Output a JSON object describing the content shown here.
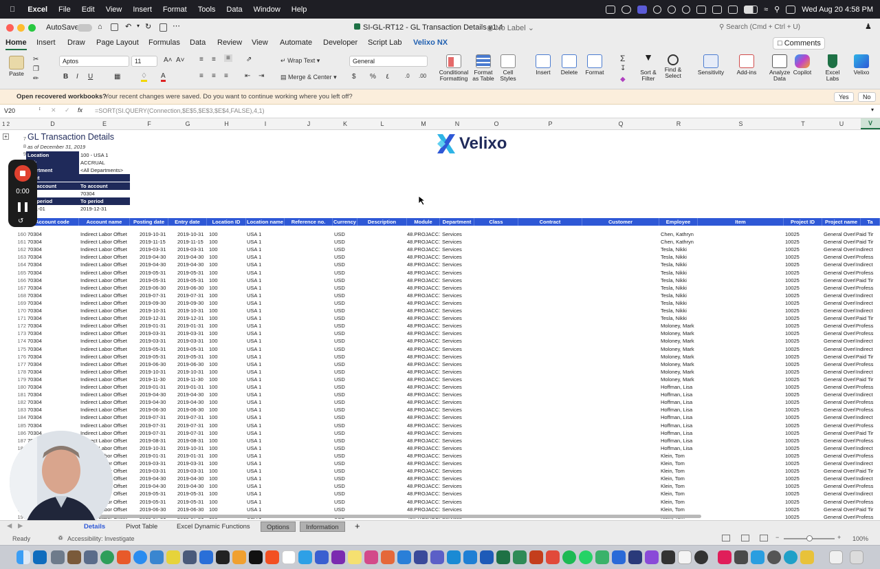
{
  "menubar": {
    "app": "Excel",
    "items": [
      "File",
      "Edit",
      "View",
      "Insert",
      "Format",
      "Tools",
      "Data",
      "Window",
      "Help"
    ],
    "datetime": "Wed Aug 20  4:58 PM"
  },
  "titlebar": {
    "autosave": "AutoSave",
    "title": "SI-GL-RT12 - GL Transaction Details v1.4",
    "label": "No Label",
    "search_placeholder": "Search (Cmd + Ctrl + U)"
  },
  "ribbon_tabs": [
    "Home",
    "Insert",
    "Draw",
    "Page Layout",
    "Formulas",
    "Data",
    "Review",
    "View",
    "Automate",
    "Developer",
    "Script Lab",
    "Velixo NX"
  ],
  "comments": "Comments",
  "ribbon": {
    "paste": "Paste",
    "font": "Aptos",
    "size": "11",
    "wrap": "Wrap Text",
    "merge": "Merge & Center",
    "numfmt": "General",
    "cond": [
      "Conditional",
      "Formatting"
    ],
    "fat": [
      "Format",
      "as Table"
    ],
    "cellstyles": [
      "Cell",
      "Styles"
    ],
    "insert": "Insert",
    "delete": "Delete",
    "format": "Format",
    "sortfilter": [
      "Sort &",
      "Filter"
    ],
    "findselect": [
      "Find &",
      "Select"
    ],
    "sensitivity": "Sensitivity",
    "addins": "Add-ins",
    "analyze": [
      "Analyze",
      "Data"
    ],
    "copilot": "Copilot",
    "excellabs": [
      "Excel",
      "Labs"
    ],
    "velixo": "Velixo"
  },
  "infobar": {
    "title": "Open recovered workbooks?",
    "message": "Your recent changes were saved. Do you want to continue working where you left off?",
    "yes": "Yes",
    "no": "No"
  },
  "formula": {
    "cell": "V20",
    "text": "=SORT(SI.QUERY(Connection,$E$5,$E$3,$E$4,FALSE),4,1)",
    "fx": "fx"
  },
  "columns": [
    "D",
    "E",
    "F",
    "G",
    "H",
    "I",
    "J",
    "K",
    "L",
    "M",
    "N",
    "O",
    "P",
    "Q",
    "R",
    "S",
    "T",
    "U",
    "V"
  ],
  "report": {
    "title": "GL Transaction Details",
    "asof": "as of December 31, 2019",
    "brand": "Velixo",
    "params": [
      {
        "label": "Location",
        "value": "100 - USA 1"
      },
      {
        "label": "ook",
        "value": "ACCRUAL"
      },
      {
        "label": "epartment",
        "value": "<All Departments>"
      },
      {
        "label": "oject",
        "value": ""
      },
      {
        "label": "om account",
        "value": "To account"
      },
      {
        "label": "04",
        "value": "70304"
      },
      {
        "label": "om period",
        "value": "To period"
      },
      {
        "label": "9-01-01",
        "value": "2019-12-31"
      }
    ],
    "rownums_top": [
      "7",
      "8",
      "9"
    ]
  },
  "table": {
    "headers": [
      "Account code",
      "Account name",
      "Posting date",
      "Entry date",
      "Location ID",
      "Location name",
      "Reference no.",
      "Currency",
      "Description",
      "Module",
      "Department",
      "Class",
      "Contract",
      "Customer",
      "Employee",
      "Item",
      "Project ID",
      "Project name",
      "Ta"
    ],
    "rows": [
      [
        "160",
        "70304",
        "Indirect Labor Offset",
        "2019-10-31",
        "2019-10-31",
        "100",
        "USA 1",
        "USD",
        "48.PROJACC1",
        "Services",
        "Chen, Kathryn",
        "10025",
        "General Overhe",
        "Paid Tir"
      ],
      [
        "161",
        "70304",
        "Indirect Labor Offset",
        "2019-11-15",
        "2019-11-15",
        "100",
        "USA 1",
        "USD",
        "48.PROJACC1",
        "Services",
        "Chen, Kathryn",
        "10025",
        "General Overhe",
        "Paid Tir"
      ],
      [
        "162",
        "70304",
        "Indirect Labor Offset",
        "2019-03-31",
        "2019-03-31",
        "100",
        "USA 1",
        "USD",
        "48.PROJACC1",
        "Services",
        "Tesla, Nikki",
        "10025",
        "General Overhe",
        "Indirect"
      ],
      [
        "163",
        "70304",
        "Indirect Labor Offset",
        "2019-04-30",
        "2019-04-30",
        "100",
        "USA 1",
        "USD",
        "48.PROJACC1",
        "Services",
        "Tesla, Nikki",
        "10025",
        "General Overhe",
        "Profess"
      ],
      [
        "164",
        "70304",
        "Indirect Labor Offset",
        "2019-04-30",
        "2019-04-30",
        "100",
        "USA 1",
        "USD",
        "48.PROJACC1",
        "Services",
        "Tesla, Nikki",
        "10025",
        "General Overhe",
        "Indirect"
      ],
      [
        "165",
        "70304",
        "Indirect Labor Offset",
        "2019-05-31",
        "2019-05-31",
        "100",
        "USA 1",
        "USD",
        "48.PROJACC1",
        "Services",
        "Tesla, Nikki",
        "10025",
        "General Overhe",
        "Profess"
      ],
      [
        "166",
        "70304",
        "Indirect Labor Offset",
        "2019-05-31",
        "2019-05-31",
        "100",
        "USA 1",
        "USD",
        "48.PROJACC1",
        "Services",
        "Tesla, Nikki",
        "10025",
        "General Overhe",
        "Paid Tir"
      ],
      [
        "167",
        "70304",
        "Indirect Labor Offset",
        "2019-06-30",
        "2019-06-30",
        "100",
        "USA 1",
        "USD",
        "48.PROJACC1",
        "Services",
        "Tesla, Nikki",
        "10025",
        "General Overhe",
        "Profess"
      ],
      [
        "168",
        "70304",
        "Indirect Labor Offset",
        "2019-07-31",
        "2019-07-31",
        "100",
        "USA 1",
        "USD",
        "48.PROJACC1",
        "Services",
        "Tesla, Nikki",
        "10025",
        "General Overhe",
        "Indirect"
      ],
      [
        "169",
        "70304",
        "Indirect Labor Offset",
        "2019-09-30",
        "2019-09-30",
        "100",
        "USA 1",
        "USD",
        "48.PROJACC1",
        "Services",
        "Tesla, Nikki",
        "10025",
        "General Overhe",
        "Indirect"
      ],
      [
        "170",
        "70304",
        "Indirect Labor Offset",
        "2019-10-31",
        "2019-10-31",
        "100",
        "USA 1",
        "USD",
        "48.PROJACC1",
        "Services",
        "Tesla, Nikki",
        "10025",
        "General Overhe",
        "Indirect"
      ],
      [
        "171",
        "70304",
        "Indirect Labor Offset",
        "2019-12-31",
        "2019-12-31",
        "100",
        "USA 1",
        "USD",
        "48.PROJACC1",
        "Services",
        "Tesla, Nikki",
        "10025",
        "General Overhe",
        "Paid Tir"
      ],
      [
        "172",
        "70304",
        "Indirect Labor Offset",
        "2019-01-31",
        "2019-01-31",
        "100",
        "USA 1",
        "USD",
        "48.PROJACC1",
        "Services",
        "Moloney, Mark",
        "10025",
        "General Overhe",
        "Profess"
      ],
      [
        "173",
        "70304",
        "Indirect Labor Offset",
        "2019-03-31",
        "2019-03-31",
        "100",
        "USA 1",
        "USD",
        "48.PROJACC1",
        "Services",
        "Moloney, Mark",
        "10025",
        "General Overhe",
        "Profess"
      ],
      [
        "174",
        "70304",
        "Indirect Labor Offset",
        "2019-03-31",
        "2019-03-31",
        "100",
        "USA 1",
        "USD",
        "48.PROJACC1",
        "Services",
        "Moloney, Mark",
        "10025",
        "General Overhe",
        "Indirect"
      ],
      [
        "175",
        "70304",
        "Indirect Labor Offset",
        "2019-05-31",
        "2019-05-31",
        "100",
        "USA 1",
        "USD",
        "48.PROJACC1",
        "Services",
        "Moloney, Mark",
        "10025",
        "General Overhe",
        "Indirect"
      ],
      [
        "176",
        "70304",
        "Indirect Labor Offset",
        "2019-05-31",
        "2019-05-31",
        "100",
        "USA 1",
        "USD",
        "48.PROJACC1",
        "Services",
        "Moloney, Mark",
        "10025",
        "General Overhe",
        "Paid Tir"
      ],
      [
        "177",
        "70304",
        "Indirect Labor Offset",
        "2019-06-30",
        "2019-06-30",
        "100",
        "USA 1",
        "USD",
        "48.PROJACC1",
        "Services",
        "Moloney, Mark",
        "10025",
        "General Overhe",
        "Profess"
      ],
      [
        "178",
        "70304",
        "Indirect Labor Offset",
        "2019-10-31",
        "2019-10-31",
        "100",
        "USA 1",
        "USD",
        "48.PROJACC1",
        "Services",
        "Moloney, Mark",
        "10025",
        "General Overhe",
        "Indirect"
      ],
      [
        "179",
        "70304",
        "Indirect Labor Offset",
        "2019-11-30",
        "2019-11-30",
        "100",
        "USA 1",
        "USD",
        "48.PROJACC1",
        "Services",
        "Moloney, Mark",
        "10025",
        "General Overhe",
        "Paid Tir"
      ],
      [
        "180",
        "70304",
        "Indirect Labor Offset",
        "2019-01-31",
        "2019-01-31",
        "100",
        "USA 1",
        "USD",
        "48.PROJACC1",
        "Services",
        "Hoffman, Lisa",
        "10025",
        "General Overhe",
        "Profess"
      ],
      [
        "181",
        "70304",
        "Indirect Labor Offset",
        "2019-04-30",
        "2019-04-30",
        "100",
        "USA 1",
        "USD",
        "48.PROJACC1",
        "Services",
        "Hoffman, Lisa",
        "10025",
        "General Overhe",
        "Indirect"
      ],
      [
        "182",
        "70304",
        "Indirect Labor Offset",
        "2019-04-30",
        "2019-04-30",
        "100",
        "USA 1",
        "USD",
        "48.PROJACC1",
        "Services",
        "Hoffman, Lisa",
        "10025",
        "General Overhe",
        "Profess"
      ],
      [
        "183",
        "70304",
        "Indirect Labor Offset",
        "2019-06-30",
        "2019-06-30",
        "100",
        "USA 1",
        "USD",
        "48.PROJACC1",
        "Services",
        "Hoffman, Lisa",
        "10025",
        "General Overhe",
        "Profess"
      ],
      [
        "184",
        "70304",
        "Indirect Labor Offset",
        "2019-07-31",
        "2019-07-31",
        "100",
        "USA 1",
        "USD",
        "48.PROJACC1",
        "Services",
        "Hoffman, Lisa",
        "10025",
        "General Overhe",
        "Indirect"
      ],
      [
        "185",
        "70304",
        "Indirect Labor Offset",
        "2019-07-31",
        "2019-07-31",
        "100",
        "USA 1",
        "USD",
        "48.PROJACC1",
        "Services",
        "Hoffman, Lisa",
        "10025",
        "General Overhe",
        "Profess"
      ],
      [
        "186",
        "70304",
        "Indirect Labor Offset",
        "2019-07-31",
        "2019-07-31",
        "100",
        "USA 1",
        "USD",
        "48.PROJACC1",
        "Services",
        "Hoffman, Lisa",
        "10025",
        "General Overhe",
        "Paid Tir"
      ],
      [
        "187",
        "70304",
        "Indirect Labor Offset",
        "2019-08-31",
        "2019-08-31",
        "100",
        "USA 1",
        "USD",
        "48.PROJACC1",
        "Services",
        "Hoffman, Lisa",
        "10025",
        "General Overhe",
        "Profess"
      ],
      [
        "188",
        "70304",
        "Indirect Labor Offset",
        "2019-10-31",
        "2019-10-31",
        "100",
        "USA 1",
        "USD",
        "48.PROJACC1",
        "Services",
        "Hoffman, Lisa",
        "10025",
        "General Overhe",
        "Indirect"
      ],
      [
        "189",
        "70304",
        "Indirect Labor Offset",
        "2019-01-31",
        "2019-01-31",
        "100",
        "USA 1",
        "USD",
        "48.PROJACC1",
        "Services",
        "Klein, Tom",
        "10025",
        "General Overhe",
        "Profess"
      ],
      [
        "190",
        "70304",
        "Indirect Labor Offset",
        "2019-03-31",
        "2019-03-31",
        "100",
        "USA 1",
        "USD",
        "48.PROJACC1",
        "Services",
        "Klein, Tom",
        "10025",
        "General Overhe",
        "Indirect"
      ],
      [
        "191",
        "70304",
        "Indirect Labor Offset",
        "2019-03-31",
        "2019-03-31",
        "100",
        "USA 1",
        "USD",
        "48.PROJACC1",
        "Services",
        "Klein, Tom",
        "10025",
        "General Overhe",
        "Paid Tir"
      ],
      [
        "192",
        "70304",
        "Indirect Labor Offset",
        "2019-04-30",
        "2019-04-30",
        "100",
        "USA 1",
        "USD",
        "48.PROJACC1",
        "Services",
        "Klein, Tom",
        "10025",
        "General Overhe",
        "Indirect"
      ],
      [
        "193",
        "70304",
        "Indirect Labor Offset",
        "2019-04-30",
        "2019-04-30",
        "100",
        "USA 1",
        "USD",
        "48.PROJACC1",
        "Services",
        "Klein, Tom",
        "10025",
        "General Overhe",
        "Profess"
      ],
      [
        "194",
        "70304",
        "Indirect Labor Offset",
        "2019-05-31",
        "2019-05-31",
        "100",
        "USA 1",
        "USD",
        "48.PROJACC1",
        "Services",
        "Klein, Tom",
        "10025",
        "General Overhe",
        "Indirect"
      ],
      [
        "195",
        "70304",
        "Indirect Labor Offset",
        "2019-05-31",
        "2019-05-31",
        "100",
        "USA 1",
        "USD",
        "48.PROJACC1",
        "Services",
        "Klein, Tom",
        "10025",
        "General Overhe",
        "Profess"
      ],
      [
        "196",
        "70304",
        "Indirect Labor Offset",
        "2019-06-30",
        "2019-06-30",
        "100",
        "USA 1",
        "USD",
        "48.PROJACC1",
        "Services",
        "Klein, Tom",
        "10025",
        "General Overhe",
        "Paid Tir"
      ],
      [
        "197",
        "70304",
        "Indirect Labor Offset",
        "2019-07-31",
        "2019-07-31",
        "100",
        "USA 1",
        "USD",
        "48.PROJACC1",
        "Services",
        "Klein, Tom",
        "10025",
        "General Overhe",
        "Profess"
      ]
    ]
  },
  "sheet_tabs": [
    "Details",
    "Pivot Table",
    "Excel Dynamic Functions",
    "Options",
    "Information"
  ],
  "status": {
    "ready": "Ready",
    "accessibility": "Accessibility: Investigate",
    "zoom": "100%"
  },
  "recorder": {
    "time": "0:00"
  },
  "colors": {
    "header_blue": "#2e58d6",
    "param_dark": "#1f2a5a",
    "excel_green": "#1e7145"
  }
}
